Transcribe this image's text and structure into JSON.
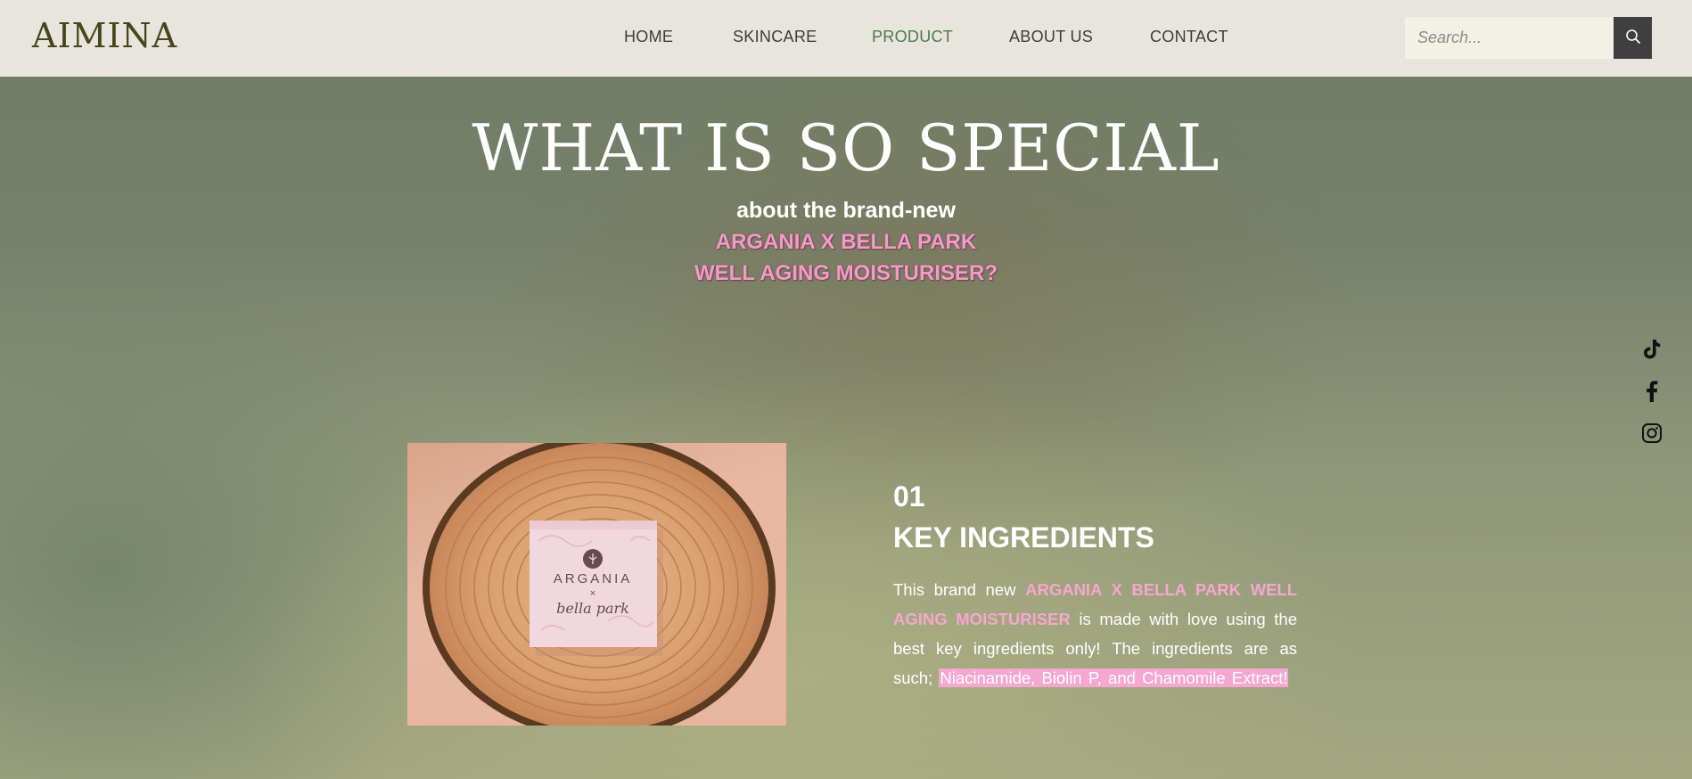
{
  "header": {
    "logo": "AIMINA",
    "nav": [
      {
        "label": "HOME",
        "active": false
      },
      {
        "label": "SKINCARE",
        "active": false
      },
      {
        "label": "PRODUCT",
        "active": true
      },
      {
        "label": "ABOUT US",
        "active": false
      },
      {
        "label": "CONTACT",
        "active": false
      }
    ],
    "search": {
      "placeholder": "Search...",
      "value": "",
      "icon": "search-icon"
    }
  },
  "hero": {
    "title": "WHAT IS SO SPECIAL",
    "subtitle": "about the brand-new",
    "product_line_1": "ARGANIA X BELLA PARK",
    "product_line_2": "WELL AGING MOISTURISER?"
  },
  "social": [
    {
      "name": "tiktok",
      "icon": "tiktok-icon"
    },
    {
      "name": "facebook",
      "icon": "facebook-icon"
    },
    {
      "name": "instagram",
      "icon": "instagram-icon"
    }
  ],
  "product_image": {
    "box_brand": "ARGANIA",
    "box_x": "×",
    "box_partner": "bella park"
  },
  "feature": {
    "number": "01",
    "title": "KEY INGREDIENTS",
    "body_prefix": "This brand new ",
    "body_product": "ARGANIA X BELLA PARK WELL AGING MOISTURISER",
    "body_middle": " is made with love using the best key ingredients only! The ingredients are as such; ",
    "body_ingredients": "Niacinamide, Biolin P, and Chamomile Extract!"
  },
  "colors": {
    "header_bg": "#e8e5de",
    "logo": "#47451a",
    "nav_active": "#4c7a4c",
    "accent_pink": "#f39bc8",
    "search_button": "#3f3f3f"
  }
}
